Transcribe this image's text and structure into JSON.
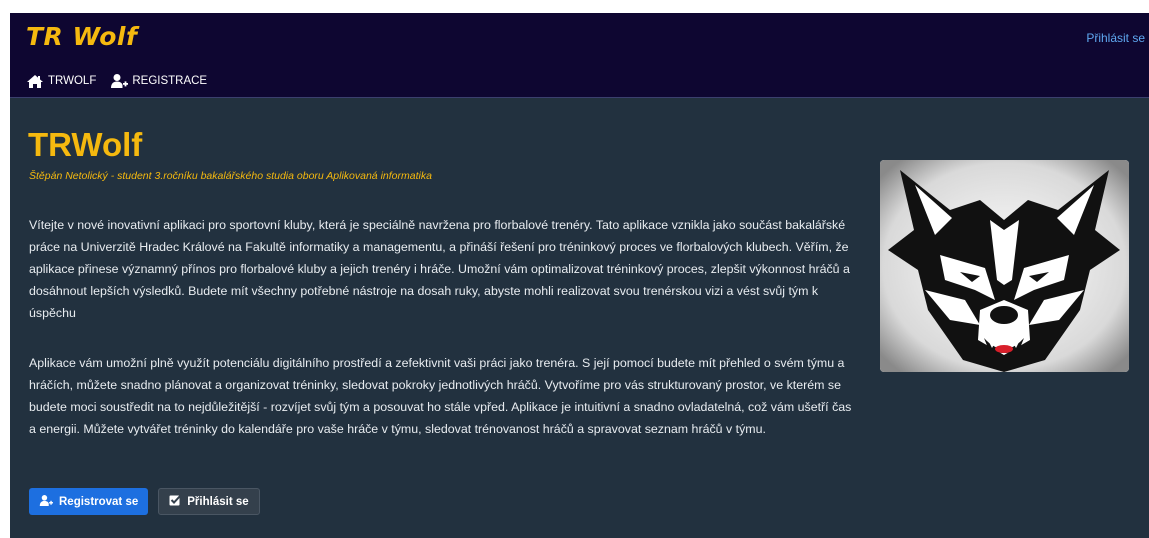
{
  "header": {
    "brand": "TR Wolf",
    "login_link": "Přihlásit se",
    "nav": [
      {
        "label": "TRWOLF",
        "icon": "home-icon"
      },
      {
        "label": "REGISTRACE",
        "icon": "user-add-icon"
      }
    ]
  },
  "hero": {
    "title": "TRWolf",
    "subtitle": "Štěpán Netolický - student 3.ročníku bakalářského studia oboru Aplikovaná informatika",
    "paragraph1": "Vítejte v nové inovativní aplikaci pro sportovní kluby, která je speciálně navržena pro florbalové trenéry. Tato aplikace vznikla jako součást bakalářské práce na Univerzitě Hradec Králové na Fakultě informatiky a managementu, a přináší řešení pro tréninkový proces ve florbalových klubech. Věřím, že aplikace přinese významný přínos pro florbalové kluby a jejich trenéry i hráče. Umožní vám optimalizovat tréninkový proces, zlepšit výkonnost hráčů a dosáhnout lepších výsledků. Budete mít všechny potřebné nástroje na dosah ruky, abyste mohli realizovat svou trenérskou vizi a vést svůj tým k úspěchu",
    "paragraph2": "Aplikace vám umožní plně využít potenciálu digitálního prostředí a zefektivnit vaši práci jako trenéra. S její pomocí budete mít přehled o svém týmu a hráčích, můžete snadno plánovat a organizovat tréninky, sledovat pokroky jednotlivých hráčů. Vytvoříme pro vás strukturovaný prostor, ve kterém se budete moci soustředit na to nejdůležitější - rozvíjet svůj tým a posouvat ho stále vpřed. Aplikace je intuitivní a snadno ovladatelná, což vám ušetří čas a energii. Můžete vytvářet tréninky do kalendáře pro vaše hráče v týmu, sledovat trénovanost hráčů a spravovat seznam hráčů v týmu.",
    "register_button": "Registrovat se",
    "login_button": "Přihlásit se",
    "image_icon": "wolf-logo"
  },
  "colors": {
    "header_bg": "#0e0631",
    "main_bg": "#22313f",
    "accent": "#f5b90f",
    "primary": "#1d6fe0",
    "link": "#5fa8f0"
  }
}
